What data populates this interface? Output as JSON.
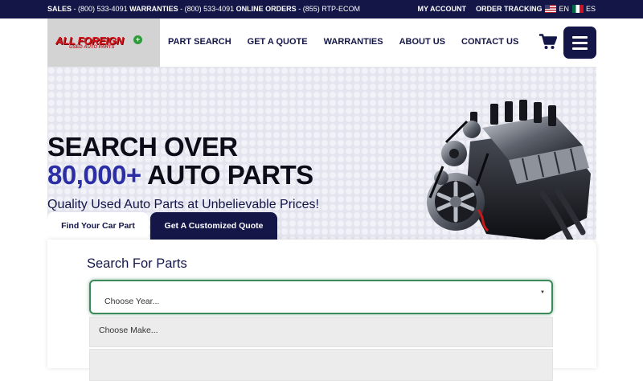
{
  "topbar": {
    "sales_label": "SALES",
    "sales_phone": "- (800) 533-4091",
    "warranties_label": "WARRANTIES",
    "warranties_phone": "- (800) 533-4091",
    "online_label": "ONLINE ORDERS",
    "online_phone": "- (855) RTP-ECOM",
    "my_account": "MY ACCOUNT",
    "order_tracking": "ORDER TRACKING",
    "lang_en": "EN",
    "lang_es": "ES"
  },
  "logo": {
    "main": "ALL FOREIGN",
    "sub": "USED AUTO PARTS",
    "badge": "+"
  },
  "nav": {
    "items": [
      "PART SEARCH",
      "GET A QUOTE",
      "WARRANTIES",
      "ABOUT US",
      "CONTACT US"
    ]
  },
  "icons": {
    "cart": "cart-icon",
    "menu": "hamburger-menu-icon",
    "engine": "engine-image"
  },
  "hero": {
    "line1": "SEARCH OVER",
    "line2_accent": "80,000+",
    "line2_rest": " AUTO PARTS",
    "subline": "Quality Used Auto Parts at Unbelievable Prices!"
  },
  "tabs": {
    "find": "Find Your Car Part",
    "quote": "Get A Customized Quote"
  },
  "search": {
    "title": "Search For Parts",
    "year_placeholder": "Choose Year...",
    "make_placeholder": "Choose Make..."
  },
  "colors": {
    "navy": "#131647",
    "accent": "#2b2ea4",
    "logo_red": "#d8141c",
    "focus_green": "#3c8a5b"
  }
}
